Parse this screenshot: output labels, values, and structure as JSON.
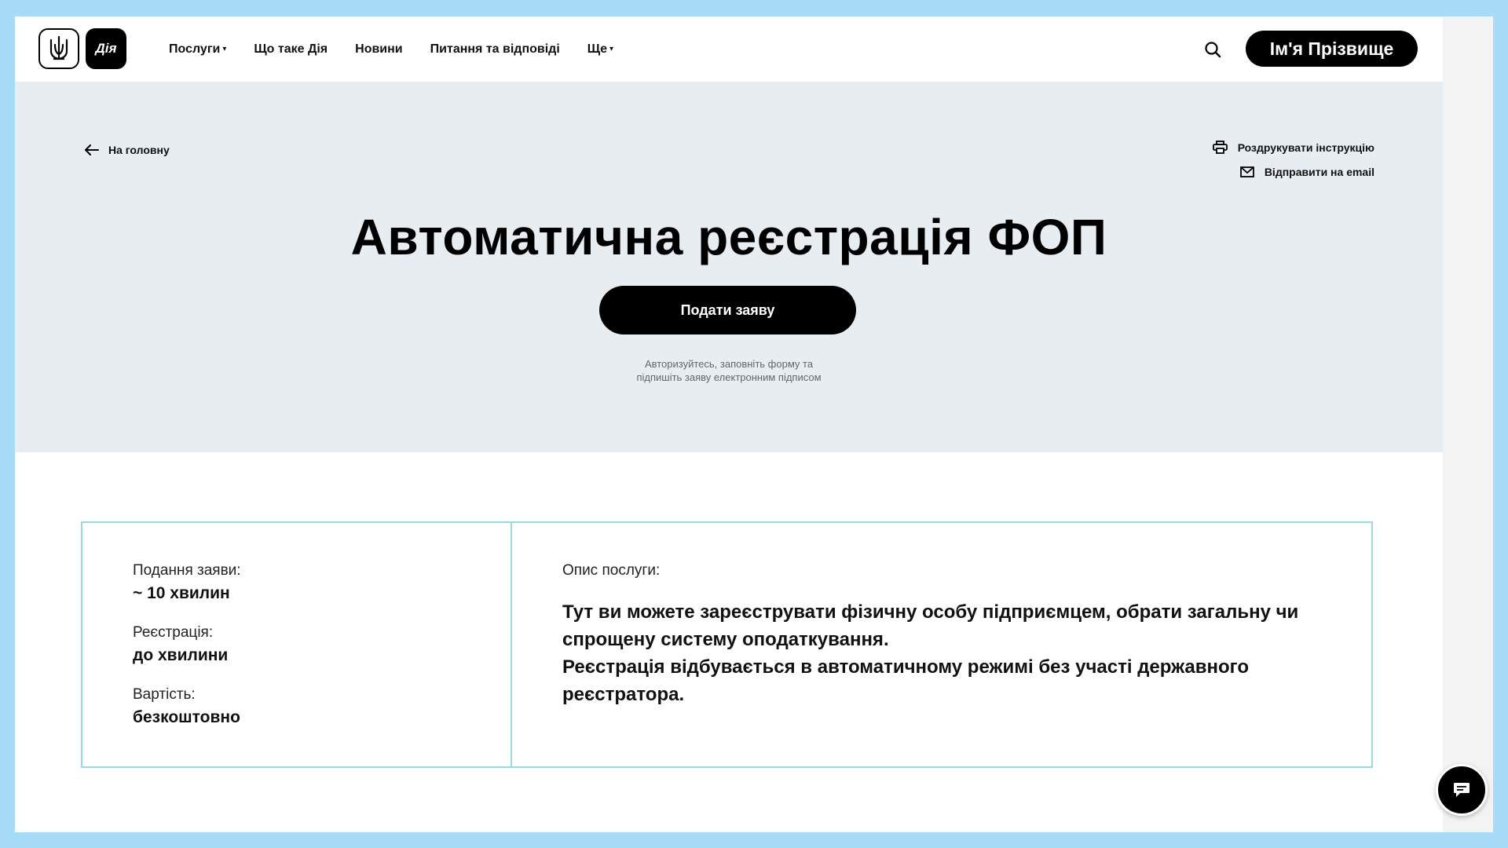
{
  "header": {
    "logo_trident": "trident-icon",
    "logo_text": "Дія",
    "nav": [
      {
        "label": "Послуги",
        "caret": "▾"
      },
      {
        "label": "Що таке Дія"
      },
      {
        "label": "Новини"
      },
      {
        "label": "Питання та відповіді"
      },
      {
        "label": "Ще",
        "caret": "▾"
      }
    ],
    "user_name": "Ім'я Прізвище"
  },
  "hero": {
    "back_label": "На головну",
    "print_label": "Роздрукувати інструкцію",
    "email_label": "Відправити на email",
    "title": "Автоматична реєстрація ФОП",
    "submit_label": "Подати заяву",
    "note_line1": "Авторизуйтесь, заповніть форму та",
    "note_line2": "підпишіть заяву електронним підписом"
  },
  "card": {
    "meta": [
      {
        "label": "Подання заяви:",
        "value": "~ 10 хвилин"
      },
      {
        "label": "Реєстрація:",
        "value": "до хвилини"
      },
      {
        "label": "Вартість:",
        "value": "безкоштовно"
      }
    ],
    "desc_label": "Опис послуги:",
    "desc_line1": "Тут ви можете зареєструвати фізичну особу підприємцем, обрати загальну чи спрощену систему оподаткування.",
    "desc_line2": "Реєстрація відбувається в автоматичному режимі без участі державного реєстратора."
  },
  "colors": {
    "page_background": "#a6dcf8",
    "hero_background": "#e8edf1",
    "card_border": "#9ad9dd",
    "primary": "#000000"
  },
  "icons": [
    "trident-icon",
    "search-icon",
    "arrow-left-icon",
    "printer-icon",
    "mail-icon",
    "chat-icon"
  ]
}
